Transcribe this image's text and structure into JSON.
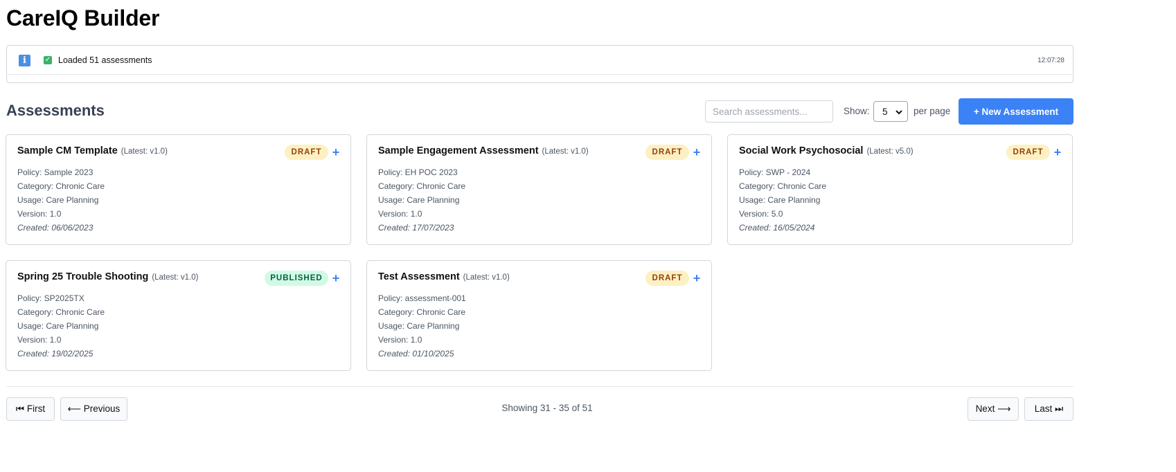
{
  "app": {
    "title": "CareIQ Builder"
  },
  "log": {
    "message": "Loaded 51 assessments",
    "time": "12:07:28"
  },
  "toolbar": {
    "section_title": "Assessments",
    "search_placeholder": "Search assessments...",
    "show_label": "Show:",
    "page_size": "5",
    "per_page_label": "per page",
    "new_button_label": "+ New Assessment"
  },
  "cards": [
    {
      "title": "Sample CM Template",
      "latest": "(Latest: v1.0)",
      "status": "DRAFT",
      "policy": "Policy: Sample 2023",
      "category": "Category: Chronic Care",
      "usage": "Usage: Care Planning",
      "version": "Version: 1.0",
      "created": "Created: 06/06/2023"
    },
    {
      "title": "Sample Engagement Assessment",
      "latest": "(Latest: v1.0)",
      "status": "DRAFT",
      "policy": "Policy: EH POC 2023",
      "category": "Category: Chronic Care",
      "usage": "Usage: Care Planning",
      "version": "Version: 1.0",
      "created": "Created: 17/07/2023"
    },
    {
      "title": "Social Work Psychosocial",
      "latest": "(Latest: v5.0)",
      "status": "DRAFT",
      "policy": "Policy: SWP - 2024",
      "category": "Category: Chronic Care",
      "usage": "Usage: Care Planning",
      "version": "Version: 5.0",
      "created": "Created: 16/05/2024"
    },
    {
      "title": "Spring 25 Trouble Shooting",
      "latest": "(Latest: v1.0)",
      "status": "PUBLISHED",
      "policy": "Policy: SP2025TX",
      "category": "Category: Chronic Care",
      "usage": "Usage: Care Planning",
      "version": "Version: 1.0",
      "created": "Created: 19/02/2025"
    },
    {
      "title": "Test Assessment",
      "latest": "(Latest: v1.0)",
      "status": "DRAFT",
      "policy": "Policy: assessment-001",
      "category": "Category: Chronic Care",
      "usage": "Usage: Care Planning",
      "version": "Version: 1.0",
      "created": "Created: 01/10/2025"
    }
  ],
  "card_add_label": "+",
  "pagination": {
    "first": "⏮ First",
    "previous": "⟵ Previous",
    "info": "Showing 31 - 35 of 51",
    "next": "Next ⟶",
    "last": "Last ⏭"
  },
  "colors": {
    "primary": "#3b82f6",
    "draft_bg": "#fdf0c2",
    "draft_text": "#92400e",
    "published_bg": "#d1fae5",
    "published_text": "#065f46",
    "info_icon": "#4a90e2",
    "success_icon": "#3bb36b"
  },
  "icons": {
    "log_info": "info-icon",
    "log_status": "check-icon",
    "select": "chevron-down-icon"
  }
}
